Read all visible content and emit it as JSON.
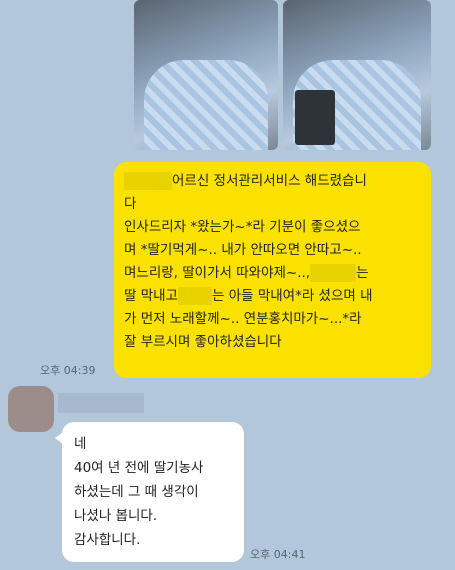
{
  "photos": [
    {
      "emoji": "kiss-heart-emoji"
    },
    {
      "emoji": "smile-emoji"
    }
  ],
  "outgoing": {
    "lines": [
      [
        "",
        "어르신 정서관리서비스 해드렸습니"
      ],
      [
        "다"
      ],
      [
        "인사드리자 *왔는가~*라 기분이 좋으셨으"
      ],
      [
        "며 *딸기먹게~.. 내가 안따오면 안따고~.."
      ],
      [
        "며느리랑, 딸이가서 따와야제~..,",
        "",
        "는"
      ],
      [
        "딸 막내고",
        "",
        "는 아들 막내여*라 셨으며 내"
      ],
      [
        "가 먼저 노래할께~.. 연분홍치마가~...*라"
      ],
      [
        "잘 부르시며 좋아하셨습니다"
      ]
    ],
    "time": "오후 04:39"
  },
  "incoming": {
    "lines": [
      "네",
      "40여 년 전에 딸기농사",
      "하셨는데 그 때 생각이",
      "나셨나 봅니다.",
      "감사합니다."
    ],
    "time": "오후 04:41"
  }
}
